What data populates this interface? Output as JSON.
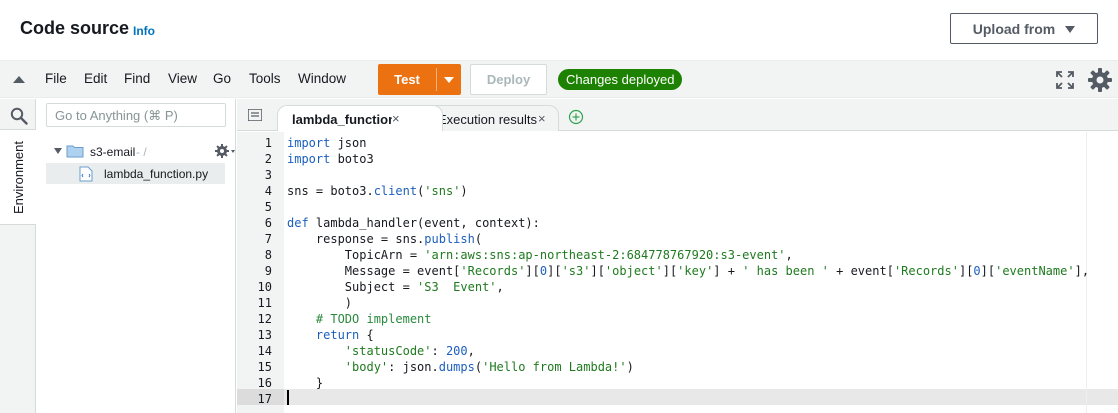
{
  "header": {
    "title": "Code source",
    "info_link": "Info",
    "upload_button": "Upload from"
  },
  "menubar": {
    "items": [
      "File",
      "Edit",
      "Find",
      "View",
      "Go",
      "Tools",
      "Window"
    ],
    "test_button": "Test",
    "deploy_button": "Deploy",
    "status": "Changes deployed",
    "colors": {
      "test": "#ec7211",
      "status": "#1d8102"
    }
  },
  "sidebar": {
    "tab_label": "Environment",
    "search_placeholder": "Go to Anything (⌘ P)",
    "folder": {
      "name": "s3-email",
      "suffix": "- /"
    },
    "file": {
      "name": "lambda_function.py"
    }
  },
  "editor": {
    "tabs": [
      {
        "label": "lambda_function",
        "close": "×"
      },
      {
        "label": "Execution results",
        "close": "×"
      }
    ],
    "active_line": 17,
    "line_numbers": [
      "1",
      "2",
      "3",
      "4",
      "5",
      "6",
      "7",
      "8",
      "9",
      "10",
      "11",
      "12",
      "13",
      "14",
      "15",
      "16",
      "17"
    ],
    "code": [
      [
        {
          "t": "import",
          "c": "kw"
        },
        {
          "t": " json",
          "c": ""
        }
      ],
      [
        {
          "t": "import",
          "c": "kw"
        },
        {
          "t": " boto3",
          "c": ""
        }
      ],
      [],
      [
        {
          "t": "sns = boto3.",
          "c": ""
        },
        {
          "t": "client",
          "c": "fn"
        },
        {
          "t": "(",
          "c": ""
        },
        {
          "t": "'sns'",
          "c": "str"
        },
        {
          "t": ")",
          "c": ""
        }
      ],
      [],
      [
        {
          "t": "def",
          "c": "kw"
        },
        {
          "t": " lambda_handler(event, context):",
          "c": ""
        }
      ],
      [
        {
          "t": "    response = sns.",
          "c": ""
        },
        {
          "t": "publish",
          "c": "fn"
        },
        {
          "t": "(",
          "c": ""
        }
      ],
      [
        {
          "t": "        TopicArn = ",
          "c": ""
        },
        {
          "t": "'arn:aws:sns:ap-northeast-2:684778767920:s3-event'",
          "c": "str"
        },
        {
          "t": ",",
          "c": ""
        }
      ],
      [
        {
          "t": "        Message = event[",
          "c": ""
        },
        {
          "t": "'Records'",
          "c": "str"
        },
        {
          "t": "][",
          "c": ""
        },
        {
          "t": "0",
          "c": "num"
        },
        {
          "t": "][",
          "c": ""
        },
        {
          "t": "'s3'",
          "c": "str"
        },
        {
          "t": "][",
          "c": ""
        },
        {
          "t": "'object'",
          "c": "str"
        },
        {
          "t": "][",
          "c": ""
        },
        {
          "t": "'key'",
          "c": "str"
        },
        {
          "t": "] + ",
          "c": ""
        },
        {
          "t": "' has been '",
          "c": "str"
        },
        {
          "t": " + event[",
          "c": ""
        },
        {
          "t": "'Records'",
          "c": "str"
        },
        {
          "t": "][",
          "c": ""
        },
        {
          "t": "0",
          "c": "num"
        },
        {
          "t": "][",
          "c": ""
        },
        {
          "t": "'eventName'",
          "c": "str"
        },
        {
          "t": "],",
          "c": ""
        }
      ],
      [
        {
          "t": "        Subject = ",
          "c": ""
        },
        {
          "t": "'S3  Event'",
          "c": "str"
        },
        {
          "t": ",",
          "c": ""
        }
      ],
      [
        {
          "t": "        )",
          "c": ""
        }
      ],
      [
        {
          "t": "    # TODO implement",
          "c": "cm"
        }
      ],
      [
        {
          "t": "    ",
          "c": ""
        },
        {
          "t": "return",
          "c": "kw"
        },
        {
          "t": " {",
          "c": ""
        }
      ],
      [
        {
          "t": "        ",
          "c": ""
        },
        {
          "t": "'statusCode'",
          "c": "str"
        },
        {
          "t": ": ",
          "c": ""
        },
        {
          "t": "200",
          "c": "num"
        },
        {
          "t": ",",
          "c": ""
        }
      ],
      [
        {
          "t": "        ",
          "c": ""
        },
        {
          "t": "'body'",
          "c": "str"
        },
        {
          "t": ": json.",
          "c": ""
        },
        {
          "t": "dumps",
          "c": "fn"
        },
        {
          "t": "(",
          "c": ""
        },
        {
          "t": "'Hello from Lambda!'",
          "c": "str"
        },
        {
          "t": ")",
          "c": ""
        }
      ],
      [
        {
          "t": "    }",
          "c": ""
        }
      ],
      []
    ]
  },
  "icons": {
    "expand": "expand-icon",
    "settings": "gear-icon",
    "search": "search-icon",
    "folder": "folder-icon",
    "file": "python-file-icon",
    "add_tab": "add-tab-icon"
  }
}
